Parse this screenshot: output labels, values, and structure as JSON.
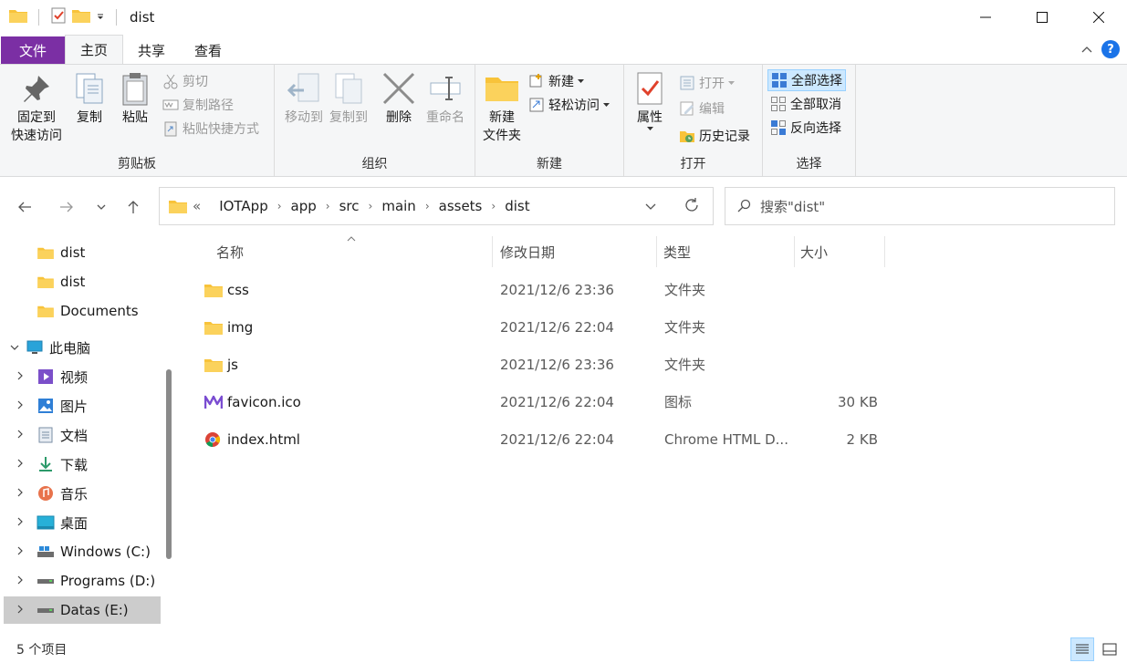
{
  "window": {
    "title": "dist"
  },
  "tabs": [
    {
      "label": "文件"
    },
    {
      "label": "主页"
    },
    {
      "label": "共享"
    },
    {
      "label": "查看"
    }
  ],
  "ribbon": {
    "clipboard": {
      "label": "剪贴板",
      "pin_line1": "固定到",
      "pin_line2": "快速访问",
      "copy": "复制",
      "paste": "粘贴",
      "cut": "剪切",
      "copy_path": "复制路径",
      "paste_shortcut": "粘贴快捷方式"
    },
    "organize": {
      "label": "组织",
      "move_to": "移动到",
      "copy_to": "复制到",
      "delete": "删除",
      "rename": "重命名"
    },
    "new": {
      "label": "新建",
      "new_folder_line1": "新建",
      "new_folder_line2": "文件夹",
      "new_item": "新建",
      "easy_access": "轻松访问"
    },
    "open": {
      "label": "打开",
      "properties": "属性",
      "open": "打开",
      "edit": "编辑",
      "history": "历史记录"
    },
    "select": {
      "label": "选择",
      "select_all": "全部选择",
      "select_none": "全部取消",
      "invert": "反向选择"
    }
  },
  "address": {
    "overflow": "«",
    "crumbs": [
      "IOTApp",
      "app",
      "src",
      "main",
      "assets",
      "dist"
    ]
  },
  "search": {
    "placeholder": "搜索\"dist\""
  },
  "sidebar": {
    "items": [
      {
        "label": "dist",
        "icon": "folder-icon",
        "chevron": ""
      },
      {
        "label": "dist",
        "icon": "folder-icon",
        "chevron": ""
      },
      {
        "label": "Documents",
        "icon": "folder-icon",
        "chevron": ""
      },
      {
        "label": "此电脑",
        "icon": "computer-icon",
        "chevron": "v"
      },
      {
        "label": "视频",
        "icon": "video-icon",
        "chevron": ">"
      },
      {
        "label": "图片",
        "icon": "pictures-icon",
        "chevron": ">"
      },
      {
        "label": "文档",
        "icon": "documents-icon",
        "chevron": ">"
      },
      {
        "label": "下载",
        "icon": "download-icon",
        "chevron": ">"
      },
      {
        "label": "音乐",
        "icon": "music-icon",
        "chevron": ">"
      },
      {
        "label": "桌面",
        "icon": "desktop-icon",
        "chevron": ">"
      },
      {
        "label": "Windows (C:)",
        "icon": "drive-icon",
        "chevron": ">"
      },
      {
        "label": "Programs (D:)",
        "icon": "drive-icon",
        "chevron": ">"
      },
      {
        "label": "Datas (E:)",
        "icon": "drive-icon",
        "chevron": ">"
      }
    ]
  },
  "columns": {
    "name": "名称",
    "date": "修改日期",
    "type": "类型",
    "size": "大小"
  },
  "files": [
    {
      "name": "css",
      "date": "2021/12/6 23:36",
      "type": "文件夹",
      "size": "",
      "icon": "folder-icon"
    },
    {
      "name": "img",
      "date": "2021/12/6 22:04",
      "type": "文件夹",
      "size": "",
      "icon": "folder-icon"
    },
    {
      "name": "js",
      "date": "2021/12/6 23:36",
      "type": "文件夹",
      "size": "",
      "icon": "folder-icon"
    },
    {
      "name": "favicon.ico",
      "date": "2021/12/6 22:04",
      "type": "图标",
      "size": "30 KB",
      "icon": "favicon-icon"
    },
    {
      "name": "index.html",
      "date": "2021/12/6 22:04",
      "type": "Chrome HTML D...",
      "size": "2 KB",
      "icon": "chrome-icon"
    }
  ],
  "status": {
    "count": "5 个项目"
  },
  "colors": {
    "file_tab": "#7b2fa4",
    "folder": "#f8c33a",
    "selection": "#cce8ff"
  }
}
